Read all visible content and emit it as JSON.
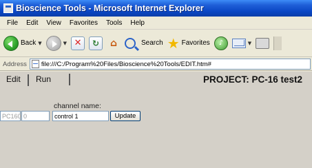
{
  "window": {
    "title": "Bioscience Tools - Microsoft Internet Explorer"
  },
  "menu": [
    "File",
    "Edit",
    "View",
    "Favorites",
    "Tools",
    "Help"
  ],
  "toolbar": {
    "back_label": "Back",
    "search_label": "Search",
    "favorites_label": "Favorites"
  },
  "address": {
    "label": "Address",
    "url": "file:///C:/Program%20Files/Bioscience%20Tools/EDIT.htm#"
  },
  "page": {
    "tabs": [
      "Edit",
      "Run"
    ],
    "project_title": "PROJECT: PC-16 test2",
    "channel_label": "channel name:",
    "device_id": "PC160",
    "channel_index": "0",
    "channel_name": "control 1",
    "update_label": "Update"
  }
}
